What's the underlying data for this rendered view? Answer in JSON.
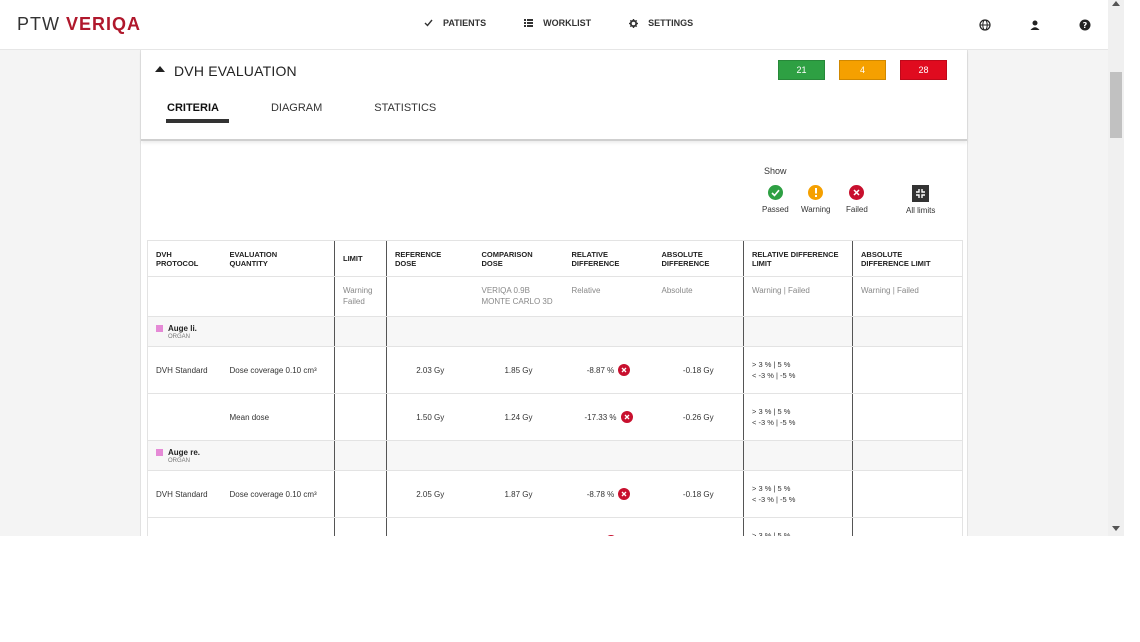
{
  "header": {
    "logo_ptw": "PTW",
    "logo_brand": "VERIQA",
    "nav": [
      {
        "label": "PATIENTS",
        "icon": "check-icon"
      },
      {
        "label": "WORKLIST",
        "icon": "list-icon"
      },
      {
        "label": "SETTINGS",
        "icon": "gear-icon"
      }
    ],
    "icons": [
      "globe-icon",
      "user-icon",
      "help-icon"
    ]
  },
  "card": {
    "title": "DVH EVALUATION",
    "badges": {
      "passed": {
        "count": "21",
        "color": "#2ea043"
      },
      "warning": {
        "count": "4",
        "color": "#f5a000"
      },
      "failed": {
        "count": "28",
        "color": "#e00b1f"
      }
    },
    "tabs": [
      {
        "label": "CRITERIA",
        "active": true
      },
      {
        "label": "DIAGRAM",
        "active": false
      },
      {
        "label": "STATISTICS",
        "active": false
      }
    ]
  },
  "show": {
    "label": "Show",
    "passed": "Passed",
    "warning": "Warning",
    "failed": "Failed",
    "all_limits": "All limits"
  },
  "table": {
    "headers": {
      "protocol": [
        "DVH",
        "PROTOCOL"
      ],
      "quantity": [
        "EVALUATION",
        "QUANTITY"
      ],
      "limit": [
        "LIMIT"
      ],
      "reference": [
        "REFERENCE",
        "DOSE"
      ],
      "comparison": [
        "COMPARISON",
        "DOSE"
      ],
      "rel_diff": [
        "RELATIVE",
        "DIFFERENCE"
      ],
      "abs_diff": [
        "ABSOLUTE",
        "DIFFERENCE"
      ],
      "rel_limit": [
        "RELATIVE DIFFERENCE",
        "LIMIT"
      ],
      "abs_limit": [
        "ABSOLUTE",
        "DIFFERENCE LIMIT"
      ]
    },
    "sub": {
      "limit": [
        "Warning",
        "Failed"
      ],
      "comparison": [
        "VERIQA 0.9B",
        "MONTE CARLO 3D"
      ],
      "rel_diff": "Relative",
      "abs_diff": "Absolute",
      "rel_limit": "Warning | Failed",
      "abs_limit": "Warning | Failed"
    },
    "organ_type": "ORGAN",
    "limit_line1": ">   3 %  |   5 %",
    "limit_line2": "<  -3 %  | -5 %",
    "organ1": "Auge li.",
    "organ2": "Auge re.",
    "row1": {
      "protocol": "DVH Standard",
      "quantity": "Dose coverage 0.10 cm³",
      "ref": "2.03 Gy",
      "comp": "1.85 Gy",
      "rel": "-8.87 %",
      "abs": "-0.18 Gy"
    },
    "row2": {
      "protocol": "",
      "quantity": "Mean dose",
      "ref": "1.50 Gy",
      "comp": "1.24 Gy",
      "rel": "-17.33 %",
      "abs": "-0.26 Gy"
    },
    "row3": {
      "protocol": "DVH Standard",
      "quantity": "Dose coverage 0.10 cm³",
      "ref": "2.05 Gy",
      "comp": "1.87 Gy",
      "rel": "-8.78 %",
      "abs": "-0.18 Gy"
    }
  }
}
